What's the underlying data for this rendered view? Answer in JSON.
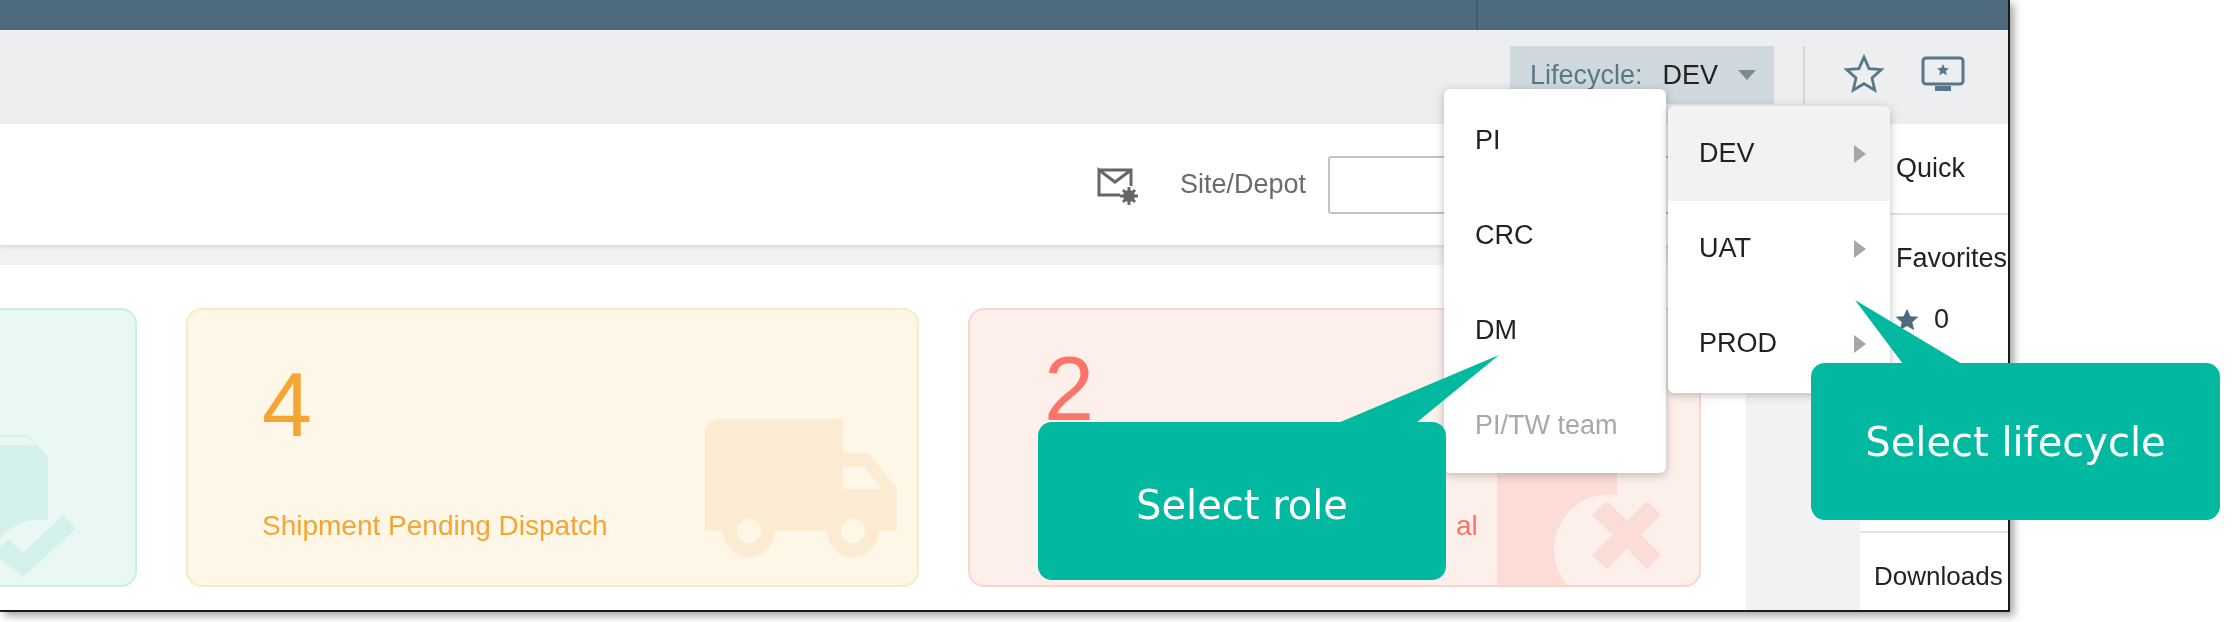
{
  "toolbar": {
    "lifecycle_label": "Lifecycle:",
    "lifecycle_value": "DEV"
  },
  "filter_bar": {
    "site_label": "Site/Depot"
  },
  "cards": [
    {
      "kind": "teal"
    },
    {
      "kind": "amber",
      "count": "4",
      "label": "Shipment Pending Dispatch"
    },
    {
      "kind": "red",
      "count": "2",
      "label": "al"
    }
  ],
  "sidebar": {
    "items": [
      {
        "kind": "link",
        "label": "Quick"
      },
      {
        "kind": "link",
        "label": "Favorites"
      },
      {
        "kind": "count",
        "label": "0"
      },
      {
        "kind": "link",
        "label": "Downloads"
      }
    ]
  },
  "role_menu": {
    "items": [
      {
        "label": "PI",
        "disabled": false
      },
      {
        "label": "CRC",
        "disabled": false
      },
      {
        "label": "DM",
        "disabled": false
      },
      {
        "label": "PI/TW team",
        "disabled": true
      }
    ]
  },
  "lifecycle_menu": {
    "items": [
      {
        "label": "DEV",
        "selected": true
      },
      {
        "label": "UAT",
        "selected": false
      },
      {
        "label": "PROD",
        "selected": false
      }
    ]
  },
  "annotations": [
    {
      "text": "Select role"
    },
    {
      "text": "Select lifecycle"
    }
  ]
}
